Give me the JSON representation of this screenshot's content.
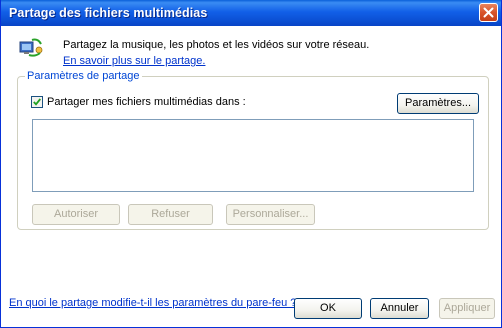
{
  "window": {
    "title": "Partage des fichiers multimédias"
  },
  "header": {
    "text": "Partagez la musique, les photos et les vidéos sur votre réseau.",
    "link": "En savoir plus sur le partage."
  },
  "sharing_group": {
    "label": "Paramètres de partage",
    "checkbox_label": "Partager mes fichiers multimédias dans :",
    "checkbox_checked": true,
    "settings_button": "Paramètres..."
  },
  "device_buttons": {
    "allow": "Autoriser",
    "deny": "Refuser",
    "customize": "Personnaliser..."
  },
  "footer": {
    "firewall_link": "En quoi le partage modifie-t-il les paramètres du pare-feu ?",
    "ok": "OK",
    "cancel": "Annuler",
    "apply": "Appliquer"
  },
  "colors": {
    "title_bar": "#0b5ae0",
    "link": "#0033cc",
    "group_label": "#0046d5"
  }
}
